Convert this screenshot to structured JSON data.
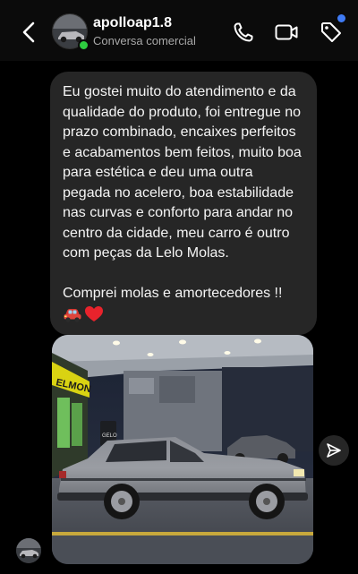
{
  "header": {
    "username": "apolloap1.8",
    "subtitle": "Conversa comercial",
    "icons": [
      "back-arrow-icon",
      "phone-icon",
      "video-call-icon",
      "tag-icon"
    ],
    "online": true,
    "notification_dot_color": "#3f7bf5"
  },
  "message": {
    "text": "Eu gostei muito do atendimento e da qualidade do produto, foi entregue no prazo combinado, encaixes perfeitos e acabamentos bem feitos, muito boa para estética e deu uma outra pegada no acelero, boa estabilidade nas curvas e conforto para andar no centro da cidade, meu carro é outro com peças da Lelo Molas.\n\nComprei molas e amortecedores !!",
    "emojis": [
      "car-emoji",
      "red-heart-emoji"
    ],
    "bubble_color": "#262626"
  },
  "photo": {
    "storefront_text": "ELMON",
    "sign_text": "GELO"
  },
  "actions": {
    "share_icon": "paper-plane-icon"
  }
}
